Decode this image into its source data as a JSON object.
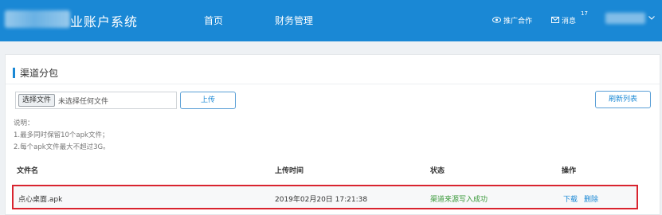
{
  "header": {
    "brand_title": "业账户系统",
    "nav": [
      {
        "label": "首页"
      },
      {
        "label": "财务管理"
      }
    ],
    "promo_label": "推广合作",
    "messages_label": "消息",
    "messages_count": "17",
    "accent_color": "#1a88d5"
  },
  "section": {
    "title": "渠道分包"
  },
  "upload": {
    "choose_label": "选择文件",
    "file_status": "未选择任何文件",
    "upload_label": "上传",
    "refresh_label": "刷新列表"
  },
  "notes": {
    "heading": "说明：",
    "line1": "1.最多同时保留10个apk文件；",
    "line2": "2.每个apk文件最大不超过3G。"
  },
  "table": {
    "headers": {
      "name": "文件名",
      "time": "上传时间",
      "status": "状态",
      "actions": "操作"
    },
    "rows": [
      {
        "name": "点心桌面.apk",
        "time": "2019年02月20日 17:21:38",
        "status": "渠道来源写入成功",
        "download": "下载",
        "delete": "删除"
      }
    ]
  }
}
